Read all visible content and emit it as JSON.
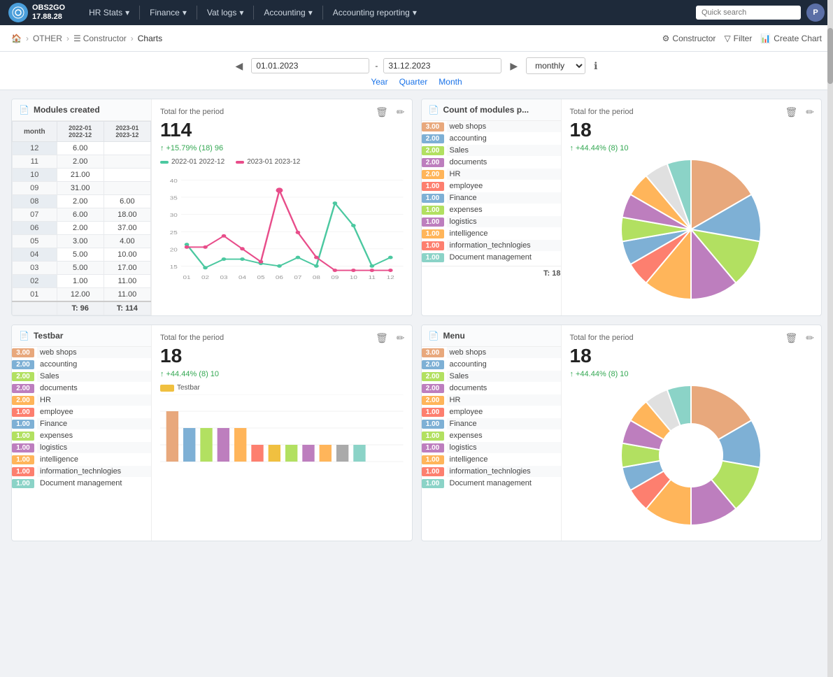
{
  "app": {
    "logo_text": "OBS2GO\n17.88.28",
    "logo_initials": "O"
  },
  "nav": {
    "items": [
      {
        "label": "HR Stats",
        "has_dropdown": true
      },
      {
        "label": "Finance",
        "has_dropdown": true
      },
      {
        "label": "Vat logs",
        "has_dropdown": true
      },
      {
        "label": "Accounting",
        "has_dropdown": true
      },
      {
        "label": "Accounting reporting",
        "has_dropdown": true
      }
    ],
    "search_placeholder": "Quick search",
    "user_initial": "P"
  },
  "breadcrumb": {
    "home": "🏠",
    "items": [
      "OTHER",
      "Constructor",
      "Charts"
    ],
    "actions": [
      "Constructor",
      "Filter",
      "Create Chart"
    ]
  },
  "date_filter": {
    "start_date": "01.01.2023",
    "end_date": "31.12.2023",
    "period": "monthly",
    "period_links": [
      "Year",
      "Quarter",
      "Month"
    ]
  },
  "chart1": {
    "title": "Modules created",
    "col1": "2022-01\n2022-12",
    "col2": "2023-01\n2023-12",
    "rows": [
      {
        "month": "12",
        "v1": "6.00",
        "v2": ""
      },
      {
        "month": "11",
        "v1": "2.00",
        "v2": ""
      },
      {
        "month": "10",
        "v1": "21.00",
        "v2": ""
      },
      {
        "month": "09",
        "v1": "31.00",
        "v2": ""
      },
      {
        "month": "08",
        "v1": "2.00",
        "v2": "6.00"
      },
      {
        "month": "07",
        "v1": "6.00",
        "v2": "18.00"
      },
      {
        "month": "06",
        "v1": "2.00",
        "v2": "37.00"
      },
      {
        "month": "05",
        "v1": "3.00",
        "v2": "4.00"
      },
      {
        "month": "04",
        "v1": "5.00",
        "v2": "10.00"
      },
      {
        "month": "03",
        "v1": "5.00",
        "v2": "17.00"
      },
      {
        "month": "02",
        "v1": "1.00",
        "v2": "11.00"
      },
      {
        "month": "01",
        "v1": "12.00",
        "v2": "11.00"
      }
    ],
    "total1": "T: 96",
    "total2": "T: 114",
    "total_label": "Total for the period",
    "total_value": "114",
    "total_change": "+15.79% (18) 96",
    "legend1": "2022-01 2022-12",
    "legend2": "2023-01 2023-12",
    "chart_data_2022": [
      12,
      1,
      5,
      5,
      3,
      2,
      6,
      2,
      31,
      21,
      2,
      6
    ],
    "chart_data_2023": [
      11,
      11,
      17,
      10,
      4,
      37,
      18,
      6,
      0,
      0,
      0,
      0
    ],
    "chart_labels": [
      "01",
      "02",
      "03",
      "04",
      "05",
      "06",
      "07",
      "08",
      "09",
      "10",
      "11",
      "12"
    ],
    "color_2022": "#4bc8a0",
    "color_2023": "#e84d8a"
  },
  "chart2": {
    "title": "Count of modules p...",
    "total_label": "Total for the period",
    "total_value": "18",
    "total_change": "+44.44% (8) 10",
    "bars": [
      {
        "value": "3.00",
        "label": "web shops",
        "color": "#e8a87c"
      },
      {
        "value": "2.00",
        "label": "accounting",
        "color": "#7eb0d5"
      },
      {
        "value": "2.00",
        "label": "Sales",
        "color": "#b2e061"
      },
      {
        "value": "2.00",
        "label": "documents",
        "color": "#bd7ebe"
      },
      {
        "value": "2.00",
        "label": "HR",
        "color": "#ffb55a"
      },
      {
        "value": "1.00",
        "label": "employee",
        "color": "#fd7f6f"
      },
      {
        "value": "1.00",
        "label": "Finance",
        "color": "#7eb0d5"
      },
      {
        "value": "1.00",
        "label": "expenses",
        "color": "#b2e061"
      },
      {
        "value": "1.00",
        "label": "logistics",
        "color": "#bd7ebe"
      },
      {
        "value": "1.00",
        "label": "intelligence",
        "color": "#ffb55a"
      },
      {
        "value": "1.00",
        "label": "information_technlogies",
        "color": "#fd7f6f"
      },
      {
        "value": "1.00",
        "label": "Document management",
        "color": "#8bd3c7"
      }
    ],
    "total": "T: 18",
    "pie_colors": [
      "#e8a87c",
      "#7eb0d5",
      "#b2e061",
      "#bd7ebe",
      "#ffb55a",
      "#fd7f6f",
      "#7eb0d5",
      "#b2e061",
      "#bd7ebe",
      "#ffb55a",
      "#e0e0e0",
      "#8bd3c7"
    ]
  },
  "chart3": {
    "title": "Testbar",
    "total_label": "Total for the period",
    "total_value": "18",
    "total_change": "+44.44% (8) 10",
    "bars": [
      {
        "value": "3.00",
        "label": "web shops",
        "color": "#e8a87c"
      },
      {
        "value": "2.00",
        "label": "accounting",
        "color": "#7eb0d5"
      },
      {
        "value": "2.00",
        "label": "Sales",
        "color": "#b2e061"
      },
      {
        "value": "2.00",
        "label": "documents",
        "color": "#bd7ebe"
      },
      {
        "value": "2.00",
        "label": "HR",
        "color": "#ffb55a"
      },
      {
        "value": "1.00",
        "label": "employee",
        "color": "#fd7f6f"
      },
      {
        "value": "1.00",
        "label": "Finance",
        "color": "#7eb0d5"
      },
      {
        "value": "1.00",
        "label": "expenses",
        "color": "#b2e061"
      },
      {
        "value": "1.00",
        "label": "logistics",
        "color": "#bd7ebe"
      },
      {
        "value": "1.00",
        "label": "intelligence",
        "color": "#ffb55a"
      },
      {
        "value": "1.00",
        "label": "information_technlogies",
        "color": "#fd7f6f"
      },
      {
        "value": "1.00",
        "label": "Document management",
        "color": "#8bd3c7"
      }
    ],
    "bar_legend": "Testbar",
    "bar_color": "#f0c040"
  },
  "chart4": {
    "title": "Menu",
    "total_label": "Total for the period",
    "total_value": "18",
    "total_change": "+44.44% (8) 10",
    "bars": [
      {
        "value": "3.00",
        "label": "web shops",
        "color": "#e8a87c"
      },
      {
        "value": "2.00",
        "label": "accounting",
        "color": "#7eb0d5"
      },
      {
        "value": "2.00",
        "label": "Sales",
        "color": "#b2e061"
      },
      {
        "value": "2.00",
        "label": "documents",
        "color": "#bd7ebe"
      },
      {
        "value": "2.00",
        "label": "HR",
        "color": "#ffb55a"
      },
      {
        "value": "1.00",
        "label": "employee",
        "color": "#fd7f6f"
      },
      {
        "value": "1.00",
        "label": "Finance",
        "color": "#7eb0d5"
      },
      {
        "value": "1.00",
        "label": "expenses",
        "color": "#b2e061"
      },
      {
        "value": "1.00",
        "label": "logistics",
        "color": "#bd7ebe"
      },
      {
        "value": "1.00",
        "label": "intelligence",
        "color": "#ffb55a"
      },
      {
        "value": "1.00",
        "label": "information_technlogies",
        "color": "#fd7f6f"
      },
      {
        "value": "1.00",
        "label": "Document management",
        "color": "#8bd3c7"
      }
    ],
    "pie_colors": [
      "#e8a87c",
      "#7eb0d5",
      "#b2e061",
      "#bd7ebe",
      "#ffb55a",
      "#fd7f6f",
      "#7eb0d5",
      "#b2e061",
      "#bd7ebe",
      "#ffb55a",
      "#e0e0e0",
      "#8bd3c7"
    ]
  }
}
